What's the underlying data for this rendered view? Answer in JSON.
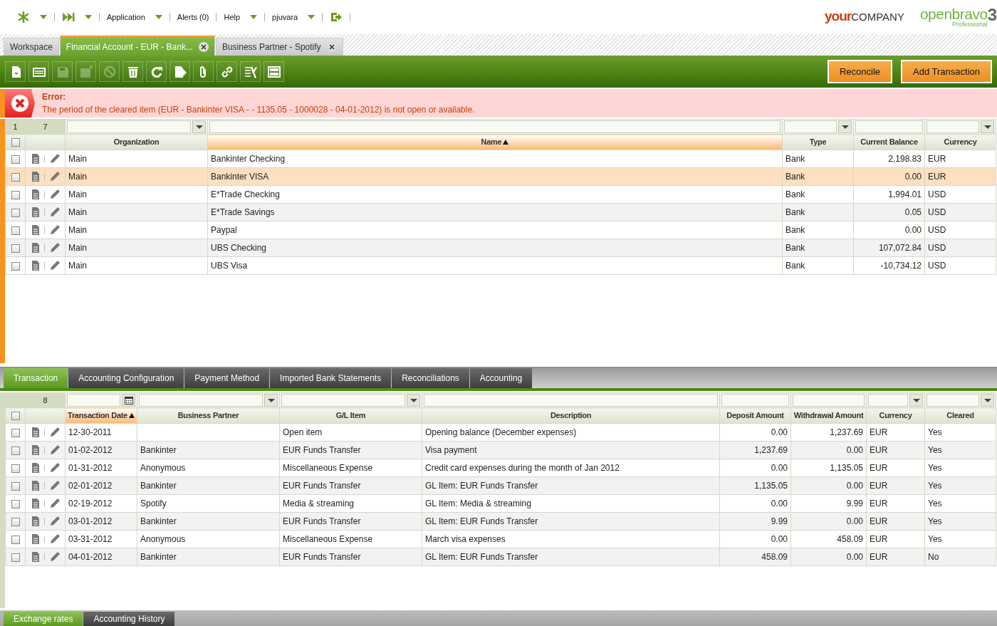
{
  "nav": [
    {
      "kind": "icon",
      "caret": true
    },
    {
      "kind": "icon",
      "caret": true
    },
    {
      "kind": "text",
      "label": "Application",
      "caret": true
    },
    {
      "kind": "text",
      "label": "Alerts (0)",
      "caret": false
    },
    {
      "kind": "text",
      "label": "Help",
      "caret": true
    },
    {
      "kind": "text",
      "label": "pjuvara",
      "caret": true
    },
    {
      "kind": "icon",
      "caret": false
    }
  ],
  "logos": {
    "company_prefix": "your",
    "company_name": "COMPANY",
    "product": "openbravo",
    "edition": "Professional",
    "version": "3"
  },
  "window_tabs": [
    {
      "label": "Workspace",
      "selected": false,
      "closable": false
    },
    {
      "label": "Financial Account - EUR - Bank...",
      "selected": true,
      "closable": true
    },
    {
      "label": "Business Partner - Spotify",
      "selected": false,
      "closable": true
    }
  ],
  "toolbar": [
    {
      "disabled": false
    },
    {
      "disabled": false
    },
    {
      "disabled": true
    },
    {
      "disabled": true
    },
    {
      "disabled": true
    },
    {
      "disabled": false
    },
    {
      "disabled": false
    },
    {
      "disabled": false
    },
    {
      "disabled": false
    },
    {
      "disabled": false
    },
    {
      "disabled": false
    },
    {
      "disabled": false
    }
  ],
  "action_buttons": [
    "Reconcile",
    "Add Transaction"
  ],
  "error": {
    "title": "Error:",
    "message": "The period of the cleared item (EUR - Bankinter VISA - - 1135.05 - 1000028 - 04-01-2012) is not open or available."
  },
  "accounts_grid": {
    "selected_count": "1",
    "total_count": "7",
    "all_checked": false,
    "columns": [
      {
        "label": "Organization",
        "kind": "select",
        "numeric": false,
        "sorted": false
      },
      {
        "label": "Name",
        "kind": "text",
        "numeric": false,
        "sorted": true
      },
      {
        "label": "Type",
        "kind": "select",
        "numeric": false,
        "sorted": false
      },
      {
        "label": "Current Balance",
        "kind": "text",
        "numeric": true,
        "sorted": false
      },
      {
        "label": "Currency",
        "kind": "select",
        "numeric": false,
        "sorted": false
      }
    ],
    "rows": [
      {
        "selected": false,
        "checked": false,
        "cells": [
          "Main",
          "Bankinter Checking",
          "Bank",
          "2,198.83",
          "EUR"
        ]
      },
      {
        "selected": true,
        "checked": false,
        "cells": [
          "Main",
          "Bankinter VISA",
          "Bank",
          "0.00",
          "EUR"
        ]
      },
      {
        "selected": false,
        "checked": false,
        "cells": [
          "Main",
          "E*Trade Checking",
          "Bank",
          "1,994.01",
          "USD"
        ]
      },
      {
        "selected": false,
        "checked": false,
        "cells": [
          "Main",
          "E*Trade Savings",
          "Bank",
          "0.05",
          "USD"
        ]
      },
      {
        "selected": false,
        "checked": false,
        "cells": [
          "Main",
          "Paypal",
          "Bank",
          "0.00",
          "USD"
        ]
      },
      {
        "selected": false,
        "checked": false,
        "cells": [
          "Main",
          "UBS Checking",
          "Bank",
          "107,072.84",
          "USD"
        ]
      },
      {
        "selected": false,
        "checked": false,
        "cells": [
          "Main",
          "UBS Visa",
          "Bank",
          "-10,734.12",
          "USD"
        ]
      }
    ]
  },
  "sub_tabs": [
    {
      "label": "Transaction",
      "selected": true
    },
    {
      "label": "Accounting Configuration",
      "selected": false
    },
    {
      "label": "Payment Method",
      "selected": false
    },
    {
      "label": "Imported Bank Statements",
      "selected": false
    },
    {
      "label": "Reconciliations",
      "selected": false
    },
    {
      "label": "Accounting",
      "selected": false
    }
  ],
  "transactions_grid": {
    "total_count": "8",
    "all_checked": false,
    "columns": [
      {
        "label": "Transaction Date",
        "kind": "date",
        "numeric": false,
        "sorted": true
      },
      {
        "label": "Business Partner",
        "kind": "select",
        "numeric": false,
        "sorted": false
      },
      {
        "label": "G/L Item",
        "kind": "select",
        "numeric": false,
        "sorted": false
      },
      {
        "label": "Description",
        "kind": "text",
        "numeric": false,
        "sorted": false
      },
      {
        "label": "Deposit Amount",
        "kind": "text",
        "numeric": true,
        "sorted": false
      },
      {
        "label": "Withdrawal Amount",
        "kind": "text",
        "numeric": true,
        "sorted": false
      },
      {
        "label": "Currency",
        "kind": "select",
        "numeric": false,
        "sorted": false
      },
      {
        "label": "Cleared",
        "kind": "select",
        "numeric": false,
        "sorted": false
      }
    ],
    "rows": [
      {
        "selected": false,
        "checked": false,
        "cells": [
          "12-30-2011",
          null,
          "Open item",
          "Opening balance (December expenses)",
          "0.00",
          "1,237.69",
          "EUR",
          "Yes"
        ]
      },
      {
        "selected": false,
        "checked": false,
        "cells": [
          "01-02-2012",
          "Bankinter",
          "EUR Funds Transfer",
          "Visa payment",
          "1,237.69",
          "0.00",
          "EUR",
          "Yes"
        ]
      },
      {
        "selected": false,
        "checked": false,
        "cells": [
          "01-31-2012",
          "Anonymous",
          "Miscellaneous Expense",
          "Credit card expenses during the month of Jan 2012",
          "0.00",
          "1,135.05",
          "EUR",
          "Yes"
        ]
      },
      {
        "selected": false,
        "checked": false,
        "cells": [
          "02-01-2012",
          "Bankinter",
          "EUR Funds Transfer",
          "GL Item: EUR Funds Transfer",
          "1,135.05",
          "0.00",
          "EUR",
          "Yes"
        ]
      },
      {
        "selected": false,
        "checked": false,
        "cells": [
          "02-19-2012",
          "Spotify",
          "Media & streaming",
          "GL Item: Media & streaming",
          "0.00",
          "9.99",
          "EUR",
          "Yes"
        ]
      },
      {
        "selected": false,
        "checked": false,
        "cells": [
          "03-01-2012",
          "Bankinter",
          "EUR Funds Transfer",
          "GL Item: EUR Funds Transfer",
          "9.99",
          "0.00",
          "EUR",
          "Yes"
        ]
      },
      {
        "selected": false,
        "checked": false,
        "cells": [
          "03-31-2012",
          "Anonymous",
          "Miscellaneous Expense",
          "March visa expenses",
          "0.00",
          "458.09",
          "EUR",
          "Yes"
        ]
      },
      {
        "selected": false,
        "checked": false,
        "cells": [
          "04-01-2012",
          "Bankinter",
          "EUR Funds Transfer",
          "GL Item: EUR Funds Transfer",
          "458.09",
          "0.00",
          "EUR",
          "No"
        ]
      }
    ]
  },
  "bottom_tabs": [
    {
      "label": "Exchange rates",
      "selected": true
    },
    {
      "label": "Accounting History",
      "selected": false
    }
  ]
}
